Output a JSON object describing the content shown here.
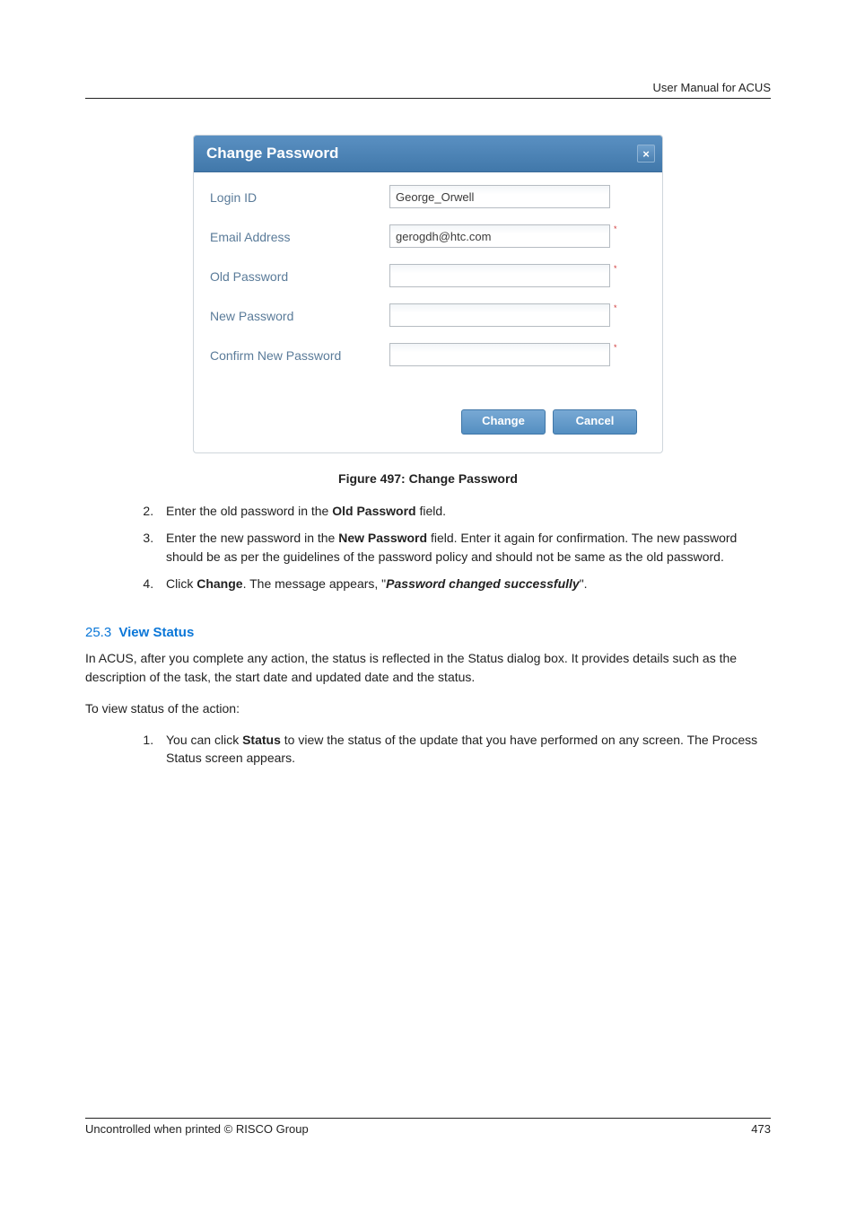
{
  "header": {
    "right_text": "User Manual for ACUS"
  },
  "dialog": {
    "title": "Change Password",
    "close_glyph": "×",
    "fields": {
      "login_id": {
        "label": "Login ID",
        "value": "George_Orwell",
        "required": false
      },
      "email": {
        "label": "Email Address",
        "value": "gerogdh@htc.com",
        "required": true
      },
      "old_pw": {
        "label": "Old Password",
        "value": "",
        "required": true
      },
      "new_pw": {
        "label": "New Password",
        "value": "",
        "required": true
      },
      "confirm_pw": {
        "label": "Confirm New Password",
        "value": "",
        "required": true
      }
    },
    "required_mark": "*",
    "buttons": {
      "change": "Change",
      "cancel": "Cancel"
    }
  },
  "figure_caption": "Figure 497: Change Password",
  "steps_first": [
    {
      "pre": "Enter the old password in the ",
      "bold1": "Old Password",
      "mid": " field.",
      "bold2": "",
      "tail": ""
    },
    {
      "pre": "Enter the new password in the ",
      "bold1": "New Password",
      "mid": " field. Enter it again for confirmation. The new password should be as per the guidelines of the password policy and should not be same as the old password.",
      "bold2": "",
      "tail": ""
    },
    {
      "pre": "Click ",
      "bold1": "Change",
      "mid": ". The message appears, \"",
      "bold2": "Password changed successfully",
      "tail": "\"."
    }
  ],
  "steps_first_start": 2,
  "section": {
    "num": "25.3",
    "name": "View Status",
    "para1": "In ACUS, after you complete any action, the status is reflected in the Status dialog box. It provides details such as the description of the task, the start date and updated date and the status.",
    "para2": "To view status of the action:"
  },
  "steps_second": [
    {
      "pre": "You can click ",
      "bold1": "Status",
      "mid": " to view the status of the update that you have performed on any screen. The Process Status screen appears.",
      "bold2": "",
      "tail": ""
    }
  ],
  "footer": {
    "left": "Uncontrolled when printed © RISCO Group",
    "right": "473"
  }
}
